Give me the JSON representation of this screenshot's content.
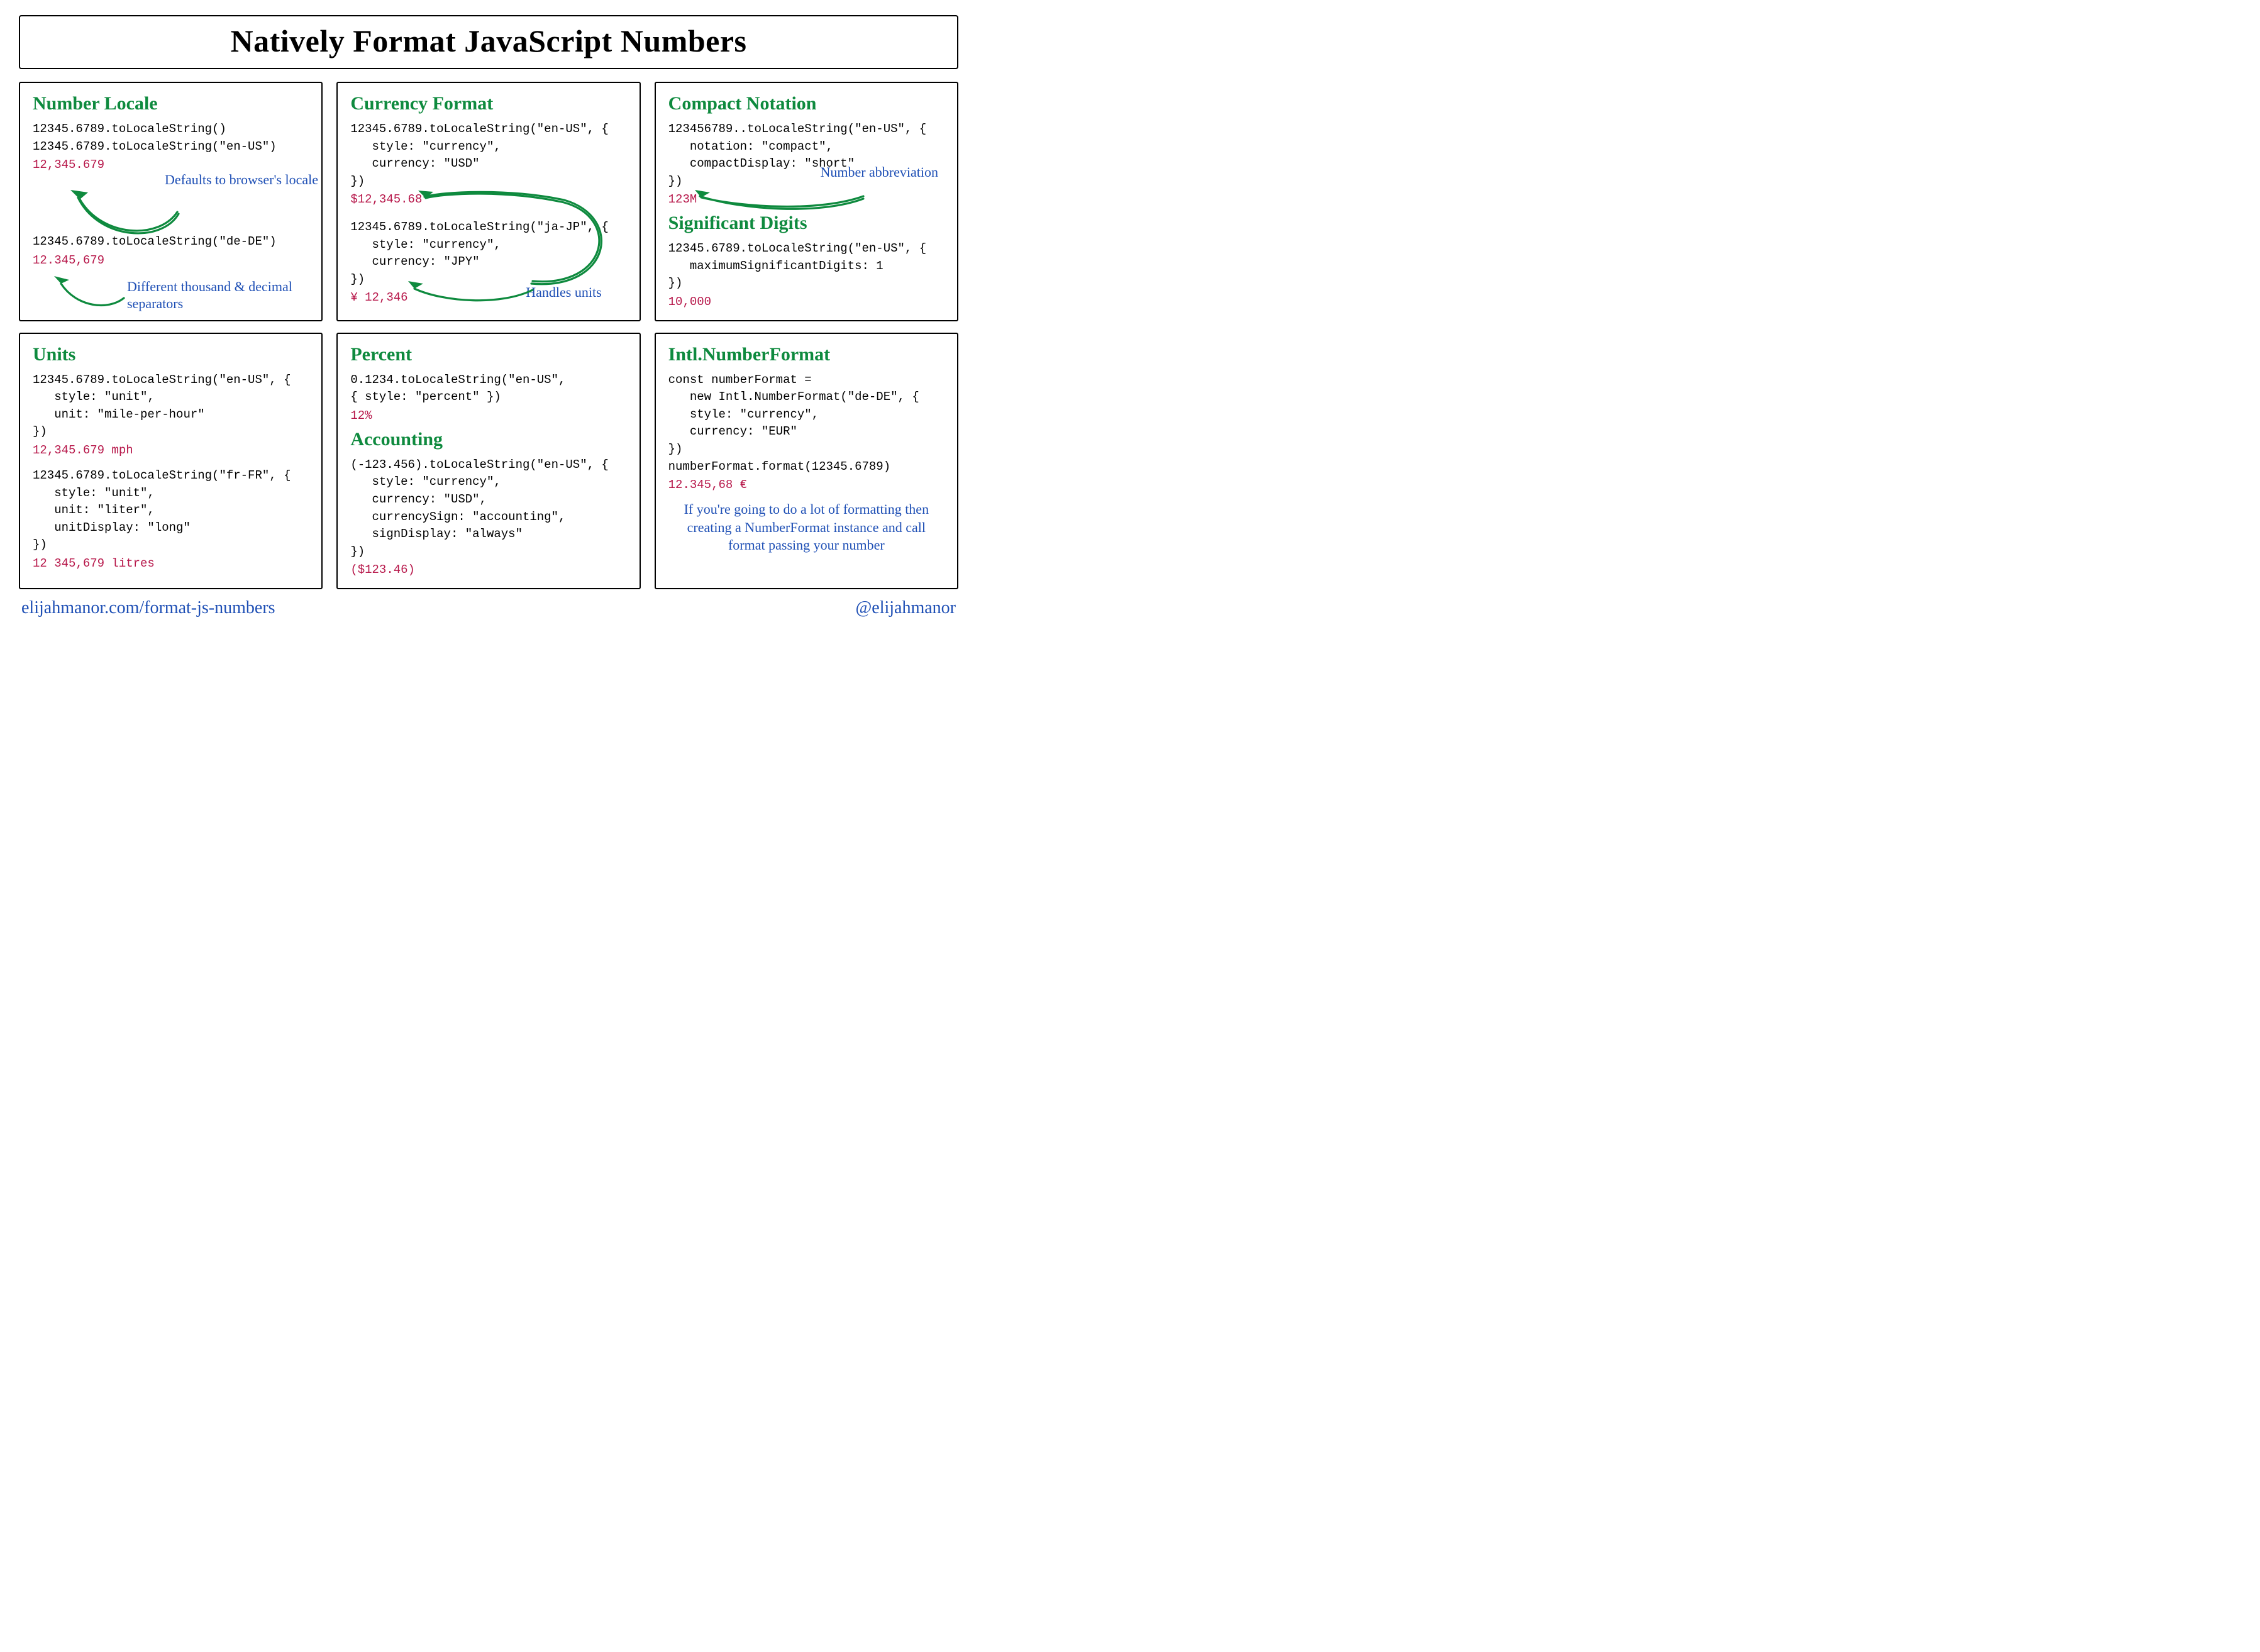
{
  "title": "Natively Format JavaScript Numbers",
  "footer": {
    "left": "elijahmanor.com/format-js-numbers",
    "right": "@elijahmanor"
  },
  "cards": {
    "locale": {
      "heading": "Number Locale",
      "code1": "12345.6789.toLocaleString()\n12345.6789.toLocaleString(\"en-US\")",
      "result1": "12,345.679",
      "annot1": "Defaults to\nbrowser's locale",
      "code2": "12345.6789.toLocaleString(\"de-DE\")",
      "result2": "12.345,679",
      "annot2": "Different thousand &\ndecimal separators"
    },
    "currency": {
      "heading": "Currency Format",
      "code1": "12345.6789.toLocaleString(\"en-US\", {\n   style: \"currency\",\n   currency: \"USD\"\n})",
      "result1": "$12,345.68",
      "code2": "12345.6789.toLocaleString(\"ja-JP\", {\n   style: \"currency\",\n   currency: \"JPY\"\n})",
      "result2": "¥ 12,346",
      "annot1": "Handles\nunits"
    },
    "compact": {
      "heading": "Compact Notation",
      "code1": "123456789..toLocaleString(\"en-US\", {\n   notation: \"compact\",\n   compactDisplay: \"short\"\n})",
      "result1": "123M",
      "annot1": "Number\nabbreviation",
      "heading2": "Significant Digits",
      "code2": "12345.6789.toLocaleString(\"en-US\", {\n   maximumSignificantDigits: 1\n})",
      "result2": "10,000"
    },
    "units": {
      "heading": "Units",
      "code1": "12345.6789.toLocaleString(\"en-US\", {\n   style: \"unit\",\n   unit: \"mile-per-hour\"\n})",
      "result1": "12,345.679 mph",
      "code2": "12345.6789.toLocaleString(\"fr-FR\", {\n   style: \"unit\",\n   unit: \"liter\",\n   unitDisplay: \"long\"\n})",
      "result2": "12 345,679 litres"
    },
    "percent": {
      "heading": "Percent",
      "code1": "0.1234.toLocaleString(\"en-US\",\n{ style: \"percent\" })",
      "result1": "12%",
      "heading2": "Accounting",
      "code2": "(-123.456).toLocaleString(\"en-US\", {\n   style: \"currency\",\n   currency: \"USD\",\n   currencySign: \"accounting\",\n   signDisplay: \"always\"\n})",
      "result2": "($123.46)"
    },
    "intl": {
      "heading": "Intl.NumberFormat",
      "code1": "const numberFormat =\n   new Intl.NumberFormat(\"de-DE\", {\n   style: \"currency\",\n   currency: \"EUR\"\n})\nnumberFormat.format(12345.6789)",
      "result1": "12.345,68 €",
      "annot1": "If you're going to do a lot of\nformatting then creating a\nNumberFormat instance and call\nformat passing your number"
    }
  }
}
